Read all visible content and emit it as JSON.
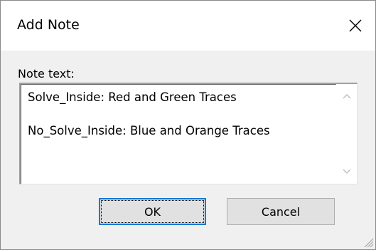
{
  "window": {
    "title": "Add Note",
    "close_icon": "close-icon"
  },
  "note": {
    "label": "Note text:",
    "lines": [
      "Solve_Inside: Red and Green Traces",
      "",
      "No_Solve_Inside: Blue and Orange Traces"
    ]
  },
  "buttons": {
    "ok_label": "OK",
    "cancel_label": "Cancel"
  },
  "colors": {
    "dialog_bg": "#f0f0f0",
    "titlebar_bg": "#ffffff",
    "default_button_border": "#0078d7",
    "button_bg": "#e1e1e1"
  }
}
